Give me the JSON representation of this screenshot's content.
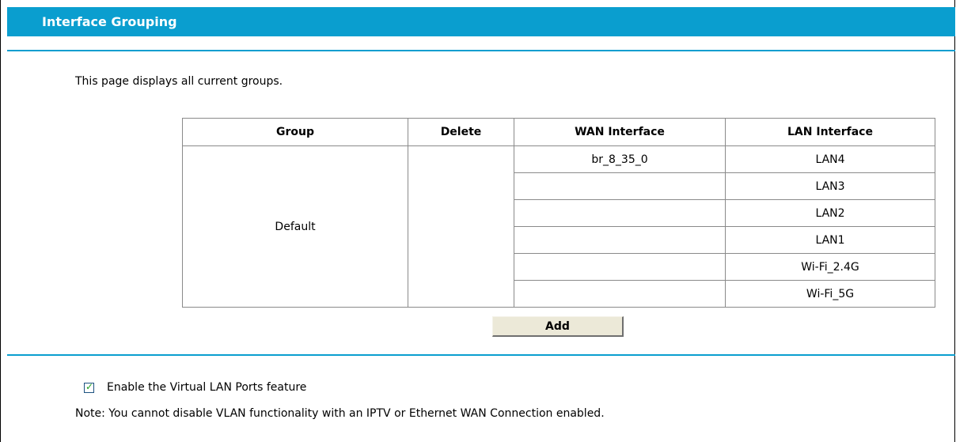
{
  "header": {
    "title": "Interface Grouping"
  },
  "intro_text": "This page displays all current groups.",
  "table": {
    "columns": [
      "Group",
      "Delete",
      "WAN Interface",
      "LAN Interface"
    ],
    "group_name": "Default",
    "rows": [
      {
        "wan": "br_8_35_0",
        "lan": "LAN4"
      },
      {
        "wan": "",
        "lan": "LAN3"
      },
      {
        "wan": "",
        "lan": "LAN2"
      },
      {
        "wan": "",
        "lan": "LAN1"
      },
      {
        "wan": "",
        "lan": "Wi-Fi_2.4G"
      },
      {
        "wan": "",
        "lan": "Wi-Fi_5G"
      }
    ]
  },
  "add_button": {
    "label": "Add"
  },
  "vlan": {
    "label": "Enable the Virtual LAN Ports feature",
    "checked": true
  },
  "note": "Note: You cannot disable VLAN functionality with an IPTV or Ethernet WAN Connection enabled.",
  "colors": {
    "accent": "#0A9ECF",
    "button_bg": "#ECE9D8",
    "check": "#21A121"
  }
}
